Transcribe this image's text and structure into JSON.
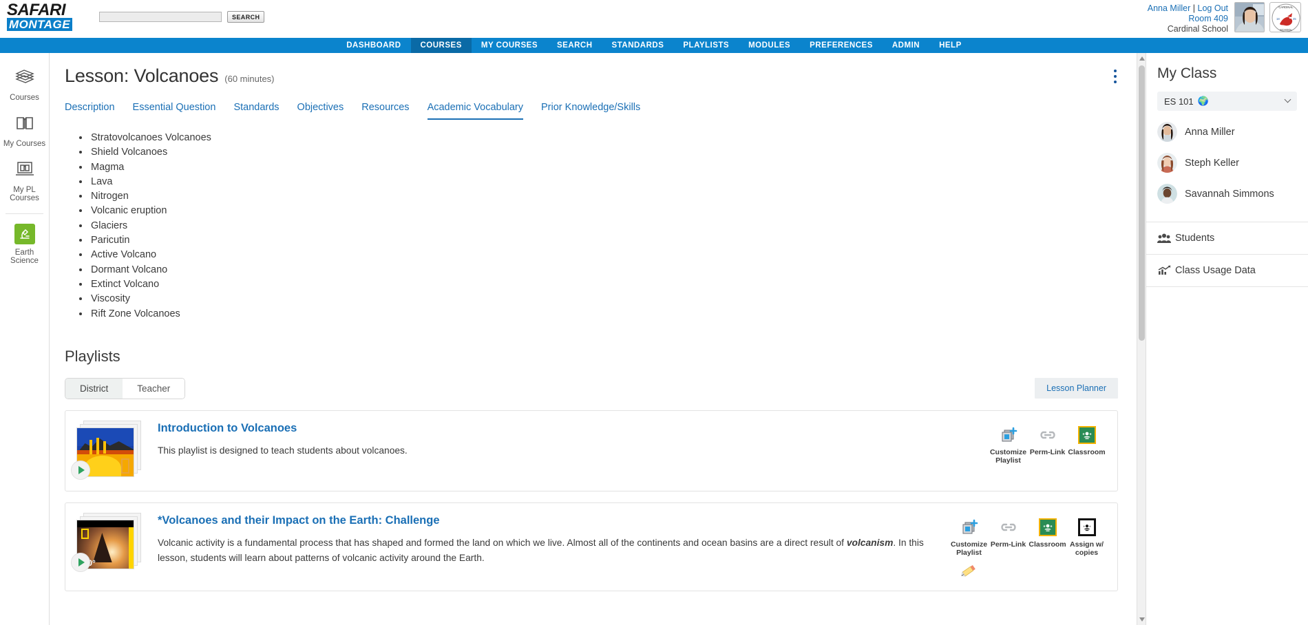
{
  "brand": {
    "line1": "SAFARI",
    "line2": "MONTAGE"
  },
  "search": {
    "value": "",
    "placeholder": "",
    "button_label": "SEARCH"
  },
  "account": {
    "user_name": "Anna Miller",
    "separator": "|",
    "logout_label": "Log Out",
    "room": "Room 409",
    "school": "Cardinal School",
    "seal_text": "CARDINAL SCHOOL",
    "seal_year": "1845"
  },
  "nav": {
    "items": [
      {
        "label": "DASHBOARD",
        "active": false
      },
      {
        "label": "COURSES",
        "active": true
      },
      {
        "label": "MY COURSES",
        "active": false
      },
      {
        "label": "SEARCH",
        "active": false
      },
      {
        "label": "STANDARDS",
        "active": false
      },
      {
        "label": "PLAYLISTS",
        "active": false
      },
      {
        "label": "MODULES",
        "active": false
      },
      {
        "label": "PREFERENCES",
        "active": false
      },
      {
        "label": "ADMIN",
        "active": false
      },
      {
        "label": "HELP",
        "active": false
      }
    ]
  },
  "rail": {
    "items": [
      {
        "label": "Courses",
        "icon": "books-icon"
      },
      {
        "label": "My Courses",
        "icon": "open-book-icon"
      },
      {
        "label": "My PL Courses",
        "label_line1": "My PL",
        "label_line2": "Courses",
        "icon": "laptop-book-icon"
      },
      {
        "label": "Earth Science",
        "label_line1": "Earth",
        "label_line2": "Science",
        "icon": "microscope-icon",
        "tile_color": "#76b82a"
      }
    ]
  },
  "lesson": {
    "title": "Lesson: Volcanoes",
    "duration": "(60 minutes)",
    "menu_icon": "kebab-menu-icon",
    "tabs": [
      {
        "label": "Description",
        "active": false
      },
      {
        "label": "Essential Question",
        "active": false
      },
      {
        "label": "Standards",
        "active": false
      },
      {
        "label": "Objectives",
        "active": false
      },
      {
        "label": "Resources",
        "active": false
      },
      {
        "label": "Academic Vocabulary",
        "active": true
      },
      {
        "label": "Prior Knowledge/Skills",
        "active": false
      }
    ],
    "vocabulary": [
      "Stratovolcanoes Volcanoes",
      "Shield Volcanoes",
      "Magma",
      "Lava",
      "Nitrogen",
      "Volcanic eruption",
      "Glaciers",
      "Paricutin",
      "Active Volcano",
      "Dormant Volcano",
      "Extinct Volcano",
      "Viscosity",
      "Rift Zone Volcanoes"
    ]
  },
  "playlists_section": {
    "heading": "Playlists",
    "toggle": [
      {
        "label": "District",
        "active": true
      },
      {
        "label": "Teacher",
        "active": false
      }
    ],
    "planner_button": "Lesson Planner",
    "items": [
      {
        "title": "Introduction to Volcanoes",
        "description": "This playlist is designed to teach students about volcanoes.",
        "thumb": "volcano-lava-thumbnail",
        "play_icon": "play-icon",
        "actions": [
          {
            "label_line1": "Customize",
            "label_line2": "Playlist",
            "icon": "customize-playlist-icon"
          },
          {
            "label_line1": "Perm-Link",
            "label_line2": "",
            "icon": "link-icon"
          },
          {
            "label_line1": "Classroom",
            "label_line2": "",
            "icon": "google-classroom-icon"
          }
        ],
        "has_pencil": false
      },
      {
        "title": "*Volcanoes and their Impact on the Earth: Challenge",
        "description_part1": "Volcanic activity is a fundamental process that has shaped and formed the land on which we live. Almost all of the continents and ocean basins are a direct result of ",
        "description_emphasis": "volcanism",
        "description_part2": ". In this lesson, students will learn about patterns of volcanic activity around the Earth.",
        "thumb": "volcano-360-thumbnail",
        "thumb_badge": "360°",
        "play_icon": "play-icon",
        "actions": [
          {
            "label_line1": "Customize",
            "label_line2": "Playlist",
            "icon": "customize-playlist-icon"
          },
          {
            "label_line1": "Perm-Link",
            "label_line2": "",
            "icon": "link-icon"
          },
          {
            "label_line1": "Classroom",
            "label_line2": "",
            "icon": "google-classroom-icon"
          },
          {
            "label_line1": "Assign w/",
            "label_line2": "copies",
            "icon": "assign-copies-icon"
          }
        ],
        "has_pencil": true,
        "pencil_icon": "pencil-icon"
      }
    ]
  },
  "my_class": {
    "heading": "My Class",
    "selected_class": "ES 101",
    "class_badge_icon": "globe-icon",
    "dropdown_icon": "chevron-down-icon",
    "students": [
      {
        "name": "Anna Miller"
      },
      {
        "name": "Steph Keller"
      },
      {
        "name": "Savannah Simmons"
      }
    ],
    "links": [
      {
        "label": "Students",
        "icon": "students-group-icon"
      },
      {
        "label": "Class Usage Data",
        "icon": "chart-trend-icon"
      }
    ]
  },
  "colors": {
    "brand_blue": "#0b84cd",
    "nav_active": "#0a6aa6",
    "link_blue": "#1a6fb5",
    "accent_green": "#76b82a",
    "classroom_green": "#2a8c54",
    "classroom_border": "#f3b200"
  }
}
